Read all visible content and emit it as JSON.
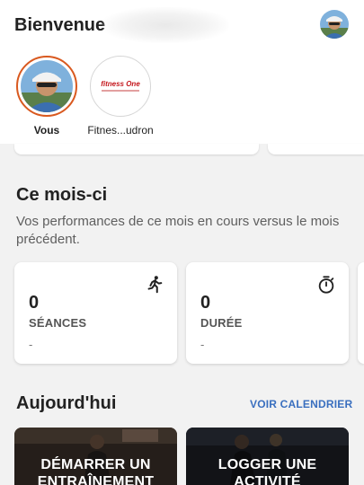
{
  "header": {
    "greeting": "Bienvenue",
    "profile_icon": "user-avatar"
  },
  "stories": [
    {
      "name": "Vous"
    },
    {
      "name": "Fitnes...udron",
      "logo_text": "fitness One"
    }
  ],
  "month": {
    "title": "Ce mois-ci",
    "subtitle": "Vos performances de ce mois en cours versus le mois précédent.",
    "stats": [
      {
        "value": "0",
        "label": "SÉANCES",
        "sub": "-",
        "icon": "running-person-icon"
      },
      {
        "value": "0",
        "label": "DURÉE",
        "sub": "-",
        "icon": "stopwatch-icon"
      }
    ]
  },
  "today": {
    "title": "Aujourd'hui",
    "calendar_link": "VOIR CALENDRIER",
    "actions": [
      {
        "label": "DÉMARRER UN ENTRAÎNEMENT"
      },
      {
        "label": "LOGGER UNE ACTIVITÉ"
      }
    ]
  },
  "colors": {
    "accent": "#d9591f",
    "link": "#3a6fbf"
  }
}
